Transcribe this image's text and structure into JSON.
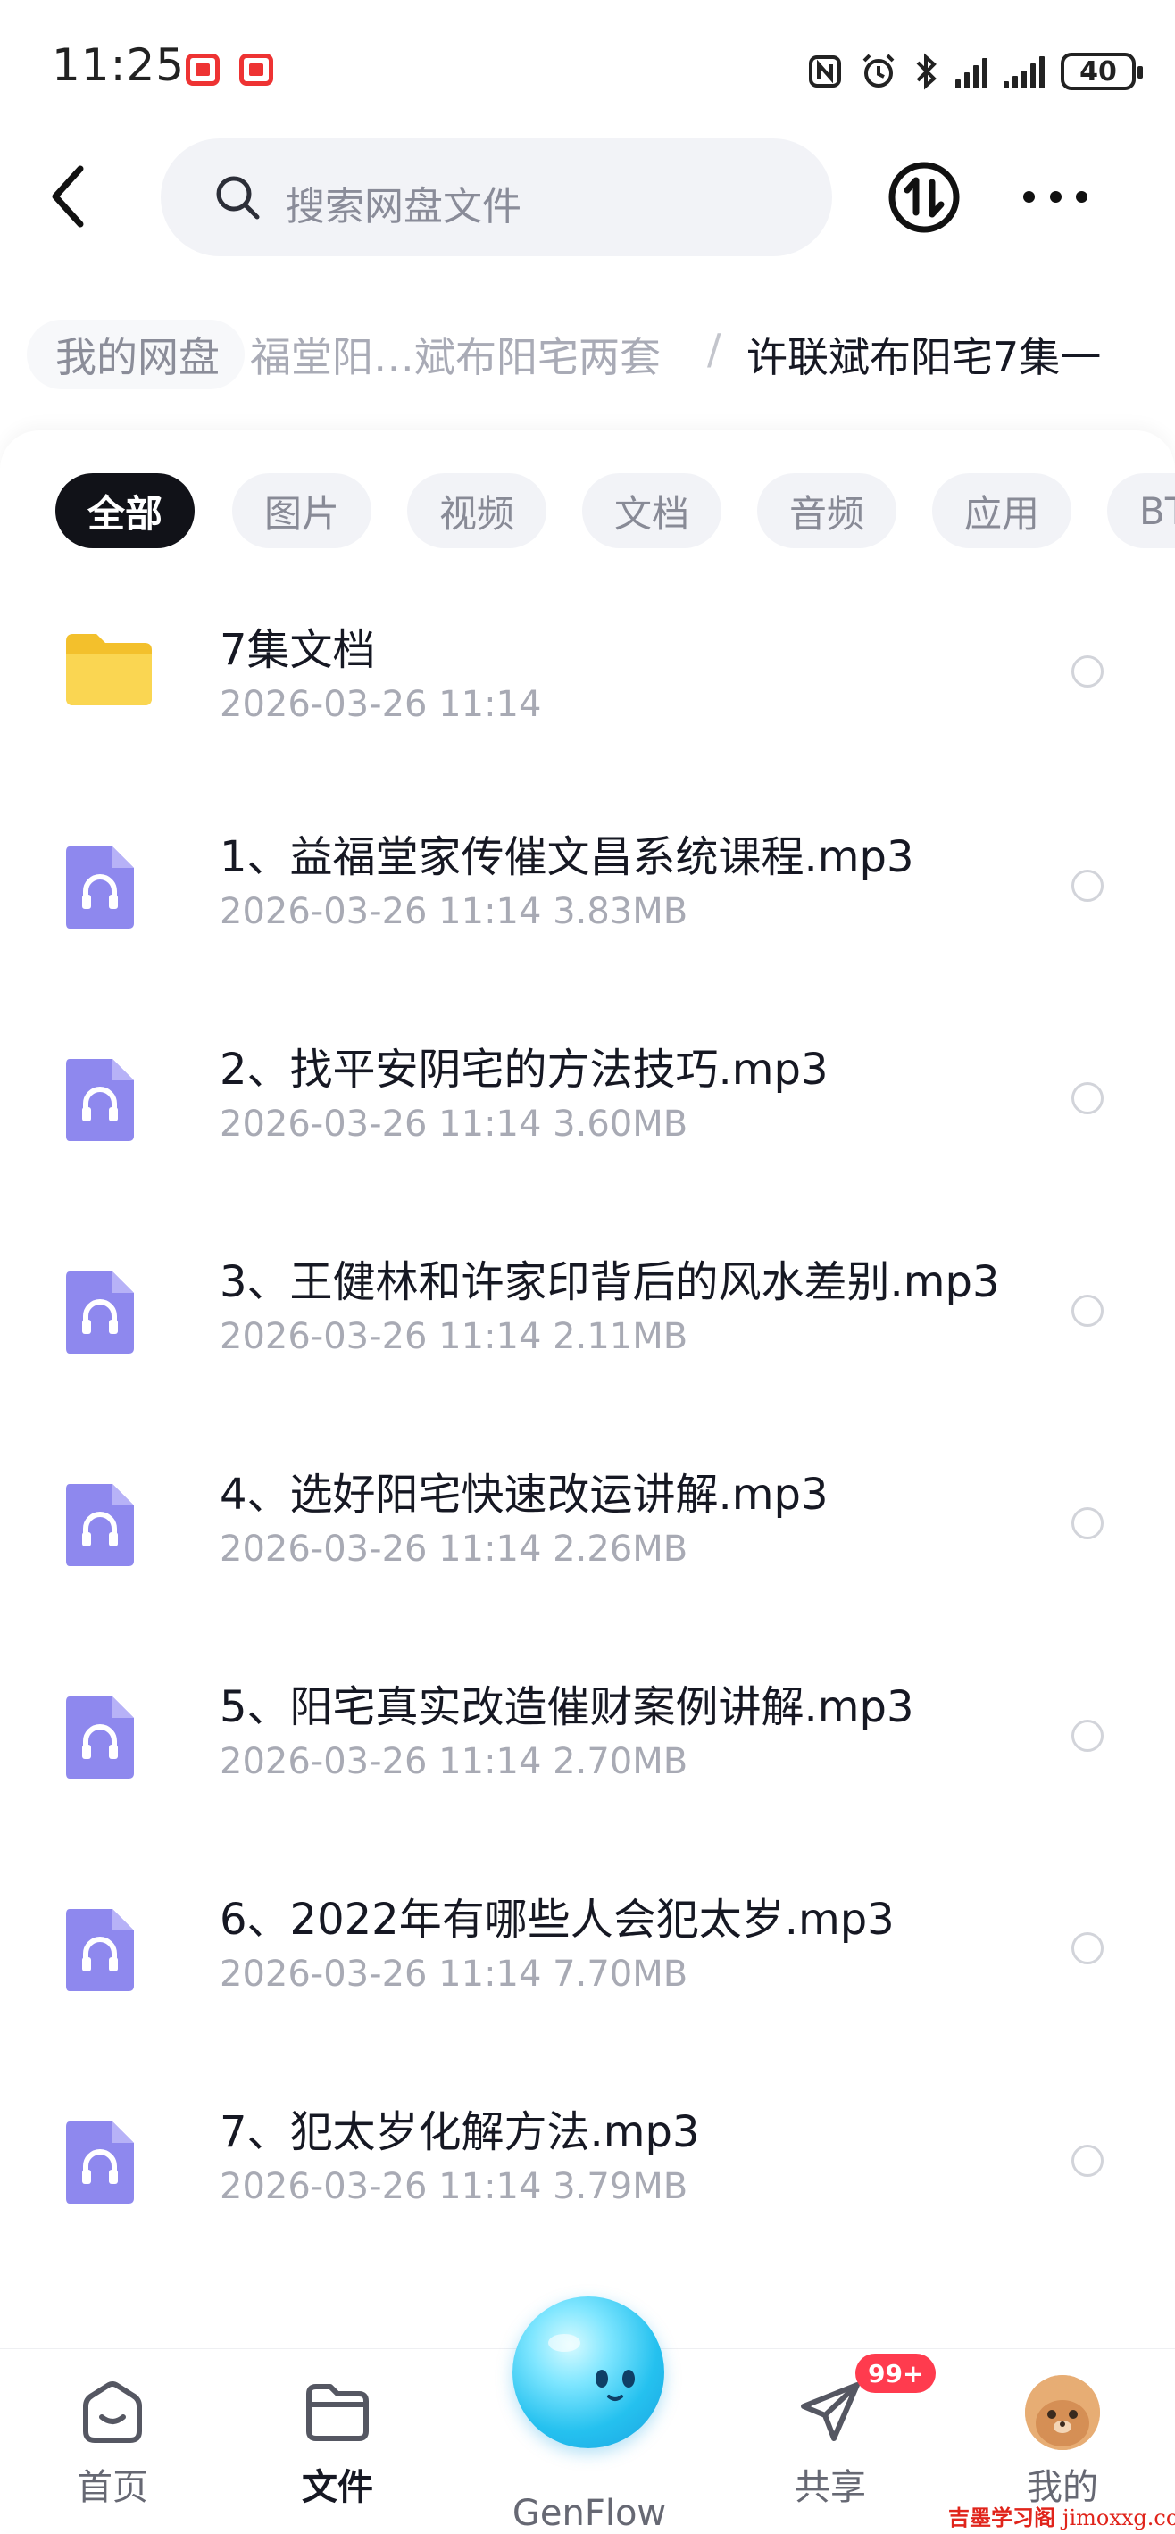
{
  "status_bar": {
    "time": "11:25",
    "battery": "40"
  },
  "header": {
    "search_placeholder": "搜索网盘文件"
  },
  "breadcrumb": {
    "root": "我的网盘",
    "middle": "福堂阳…斌布阳宅两套",
    "separator": "/",
    "current": "许联斌布阳宅7集一"
  },
  "filters": [
    {
      "label": "全部",
      "active": true
    },
    {
      "label": "图片",
      "active": false
    },
    {
      "label": "视频",
      "active": false
    },
    {
      "label": "文档",
      "active": false
    },
    {
      "label": "音频",
      "active": false
    },
    {
      "label": "应用",
      "active": false
    },
    {
      "label": "BT",
      "active": false
    }
  ],
  "files": [
    {
      "name": "7集文档",
      "meta": "2026-03-26  11:14",
      "type": "folder"
    },
    {
      "name": "1、益福堂家传催文昌系统课程.mp3",
      "meta": "2026-03-26  11:14  3.83MB",
      "type": "audio"
    },
    {
      "name": "2、找平安阴宅的方法技巧.mp3",
      "meta": "2026-03-26  11:14  3.60MB",
      "type": "audio"
    },
    {
      "name": "3、王健林和许家印背后的风水差别.mp3",
      "meta": "2026-03-26  11:14  2.11MB",
      "type": "audio"
    },
    {
      "name": "4、选好阳宅快速改运讲解.mp3",
      "meta": "2026-03-26  11:14  2.26MB",
      "type": "audio"
    },
    {
      "name": "5、阳宅真实改造催财案例讲解.mp3",
      "meta": "2026-03-26  11:14  2.70MB",
      "type": "audio"
    },
    {
      "name": "6、2022年有哪些人会犯太岁.mp3",
      "meta": "2026-03-26  11:14  7.70MB",
      "type": "audio"
    },
    {
      "name": "7、犯太岁化解方法.mp3",
      "meta": "2026-03-26  11:14  3.79MB",
      "type": "audio"
    }
  ],
  "bottom_nav": {
    "home": "首页",
    "files": "文件",
    "genflow": "GenFlow",
    "share": "共享",
    "share_badge": "99+",
    "me": "我的"
  },
  "watermark": {
    "cn": "吉墨学习阁",
    "en": "jimoxxg.com"
  },
  "colors": {
    "active_chip": "#111218",
    "audio_icon": "#8e88ee",
    "folder": "#f7cd3c",
    "badge": "#ff3b4e",
    "genflow_orb": "#25c1ef"
  }
}
